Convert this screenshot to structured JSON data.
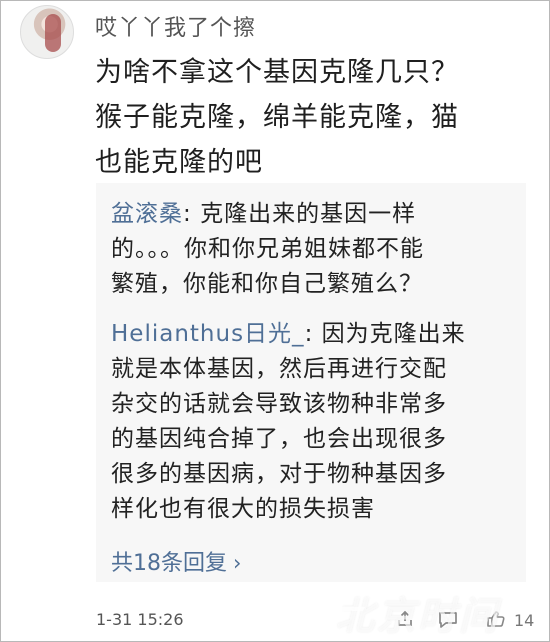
{
  "user": {
    "name": "哎丫丫我了个擦"
  },
  "comment": {
    "lines": [
      "为啥不拿这个基因克隆几只？",
      "猴子能克隆，绵羊能克隆，猫",
      "也能克隆的吧"
    ]
  },
  "replies": [
    {
      "author": "盆滚桑",
      "separator": ": ",
      "lines": [
        "克隆出来的基因一样",
        "的。。。你和你兄弟姐妹都不能",
        "繁殖，你能和你自己繁殖么？"
      ]
    },
    {
      "author": "Helianthus日光_",
      "separator": ": ",
      "lines": [
        "因为克隆出来",
        "就是本体基因，然后再进行交配",
        "杂交的话就会导致该物种非常多",
        "的基因纯合掉了，也会出现很多",
        "很多的基因病，对于物种基因多",
        "样化也有很大的损失损害"
      ]
    }
  ],
  "more_replies": {
    "label": "共18条回复",
    "arrow": "›"
  },
  "meta": {
    "timestamp": "1-31 15:26",
    "like_count": "14"
  },
  "watermark": {
    "text": "北京时间"
  },
  "icons": {
    "share": "share-icon",
    "comment": "comment-icon",
    "like": "thumbs-up-icon"
  }
}
